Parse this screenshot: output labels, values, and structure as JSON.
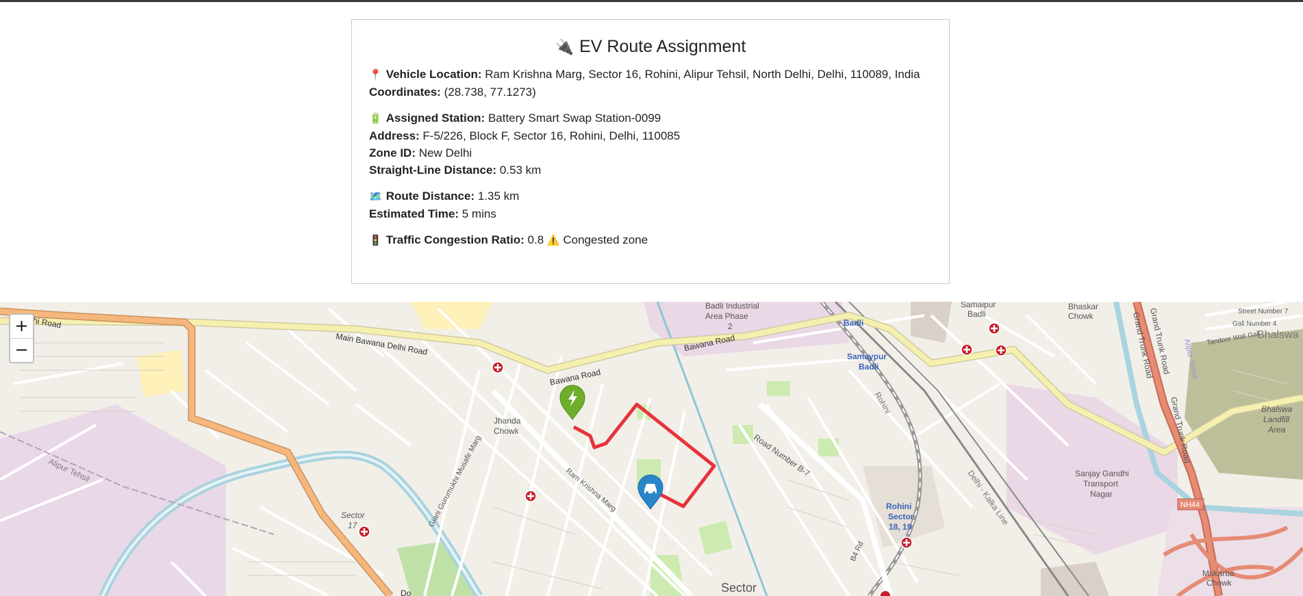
{
  "panel": {
    "title": "EV Route Assignment",
    "vehicle_location_label": "Vehicle Location:",
    "vehicle_location_value": "Ram Krishna Marg, Sector 16, Rohini, Alipur Tehsil, North Delhi, Delhi, 110089, India",
    "coordinates_label": "Coordinates:",
    "coordinates_value": "(28.738, 77.1273)",
    "assigned_station_label": "Assigned Station:",
    "assigned_station_value": "Battery Smart Swap Station-0099",
    "address_label": "Address:",
    "address_value": "F-5/226, Block F, Sector 16, Rohini, Delhi, 110085",
    "zone_label": "Zone ID:",
    "zone_value": "New Delhi",
    "straight_label": "Straight-Line Distance:",
    "straight_value": "0.53 km",
    "route_label": "Route Distance:",
    "route_value": "1.35 km",
    "time_label": "Estimated Time:",
    "time_value": "5 mins",
    "traffic_label": "Traffic Congestion Ratio:",
    "traffic_value": "0.8",
    "traffic_status": "Congested zone"
  },
  "map": {
    "zoom_in": "+",
    "zoom_out": "−",
    "labels": {
      "badli_industrial_1": "Badli Industrial",
      "badli_industrial_2": "Area Phase",
      "badli_industrial_3": "2",
      "samaypur_badli_1": "Samaipur",
      "samaypur_badli_2": "Badli",
      "badli": "Badli",
      "samaypur_station_1": "Samaypur",
      "samaypur_station_2": "Badli",
      "bhaskar_1": "Bhaskar",
      "bhaskar_2": "Chowk",
      "street_7": "Street Number 7",
      "gali_4": "Gali Number 4",
      "tandoor": "Tandoor Wali Gali",
      "bhalswa": "Bhalswa",
      "bhalswa_landfill_1": "Bhalswa",
      "bhalswa_landfill_2": "Landfill",
      "bhalswa_landfill_3": "Area",
      "grand_trunk_1": "Grand Trunk Road",
      "grand_trunk_2": "Grand Trunk Road",
      "grand_trunk_3": "Grand Trunk Road",
      "nh44": "NH44",
      "sanjay_gandhi_1": "Sanjay Gandhi",
      "sanjay_gandhi_2": "Transport",
      "sanjay_gandhi_3": "Nagar",
      "mukarba_1": "Mukarba",
      "mukarba_2": "Chowk",
      "delhi_kalka": "Delhi - Kalka Line",
      "rohini": "Rohini",
      "rohini_sector_1": "Rohini",
      "rohini_sector_2": "Sector",
      "rohini_sector_3": "18, 19",
      "road_b7": "Road Number B-7",
      "b4_rd": "B4 Rd",
      "bawana_road_1": "Bawana Road",
      "bawana_road_2": "Bawana Road",
      "main_bawana": "Main Bawana Delhi Road",
      "delhi_road": "Delhi Road",
      "jhanda_1": "Jhanda",
      "jhanda_2": "Chowk",
      "giani": "Giani Gurumukhi Musafir Marg",
      "ram_krishna": "Ram Krishna Marg",
      "alipur_tehsil": "Alipur Tehsil",
      "sector17_1": "Sector",
      "sector17_2": "17",
      "sector_bottom": "Sector",
      "do": "Do",
      "alipur_t": "Alipur Tehsil"
    }
  },
  "colors": {
    "route": "#e8333a",
    "vehicle_marker": "#2a86c8",
    "station_marker": "#6fae2b",
    "primary_road": "#f3e9a4",
    "trunk_road": "#f6b77d",
    "motorway": "#e68b74",
    "canal": "#a9d3df"
  }
}
